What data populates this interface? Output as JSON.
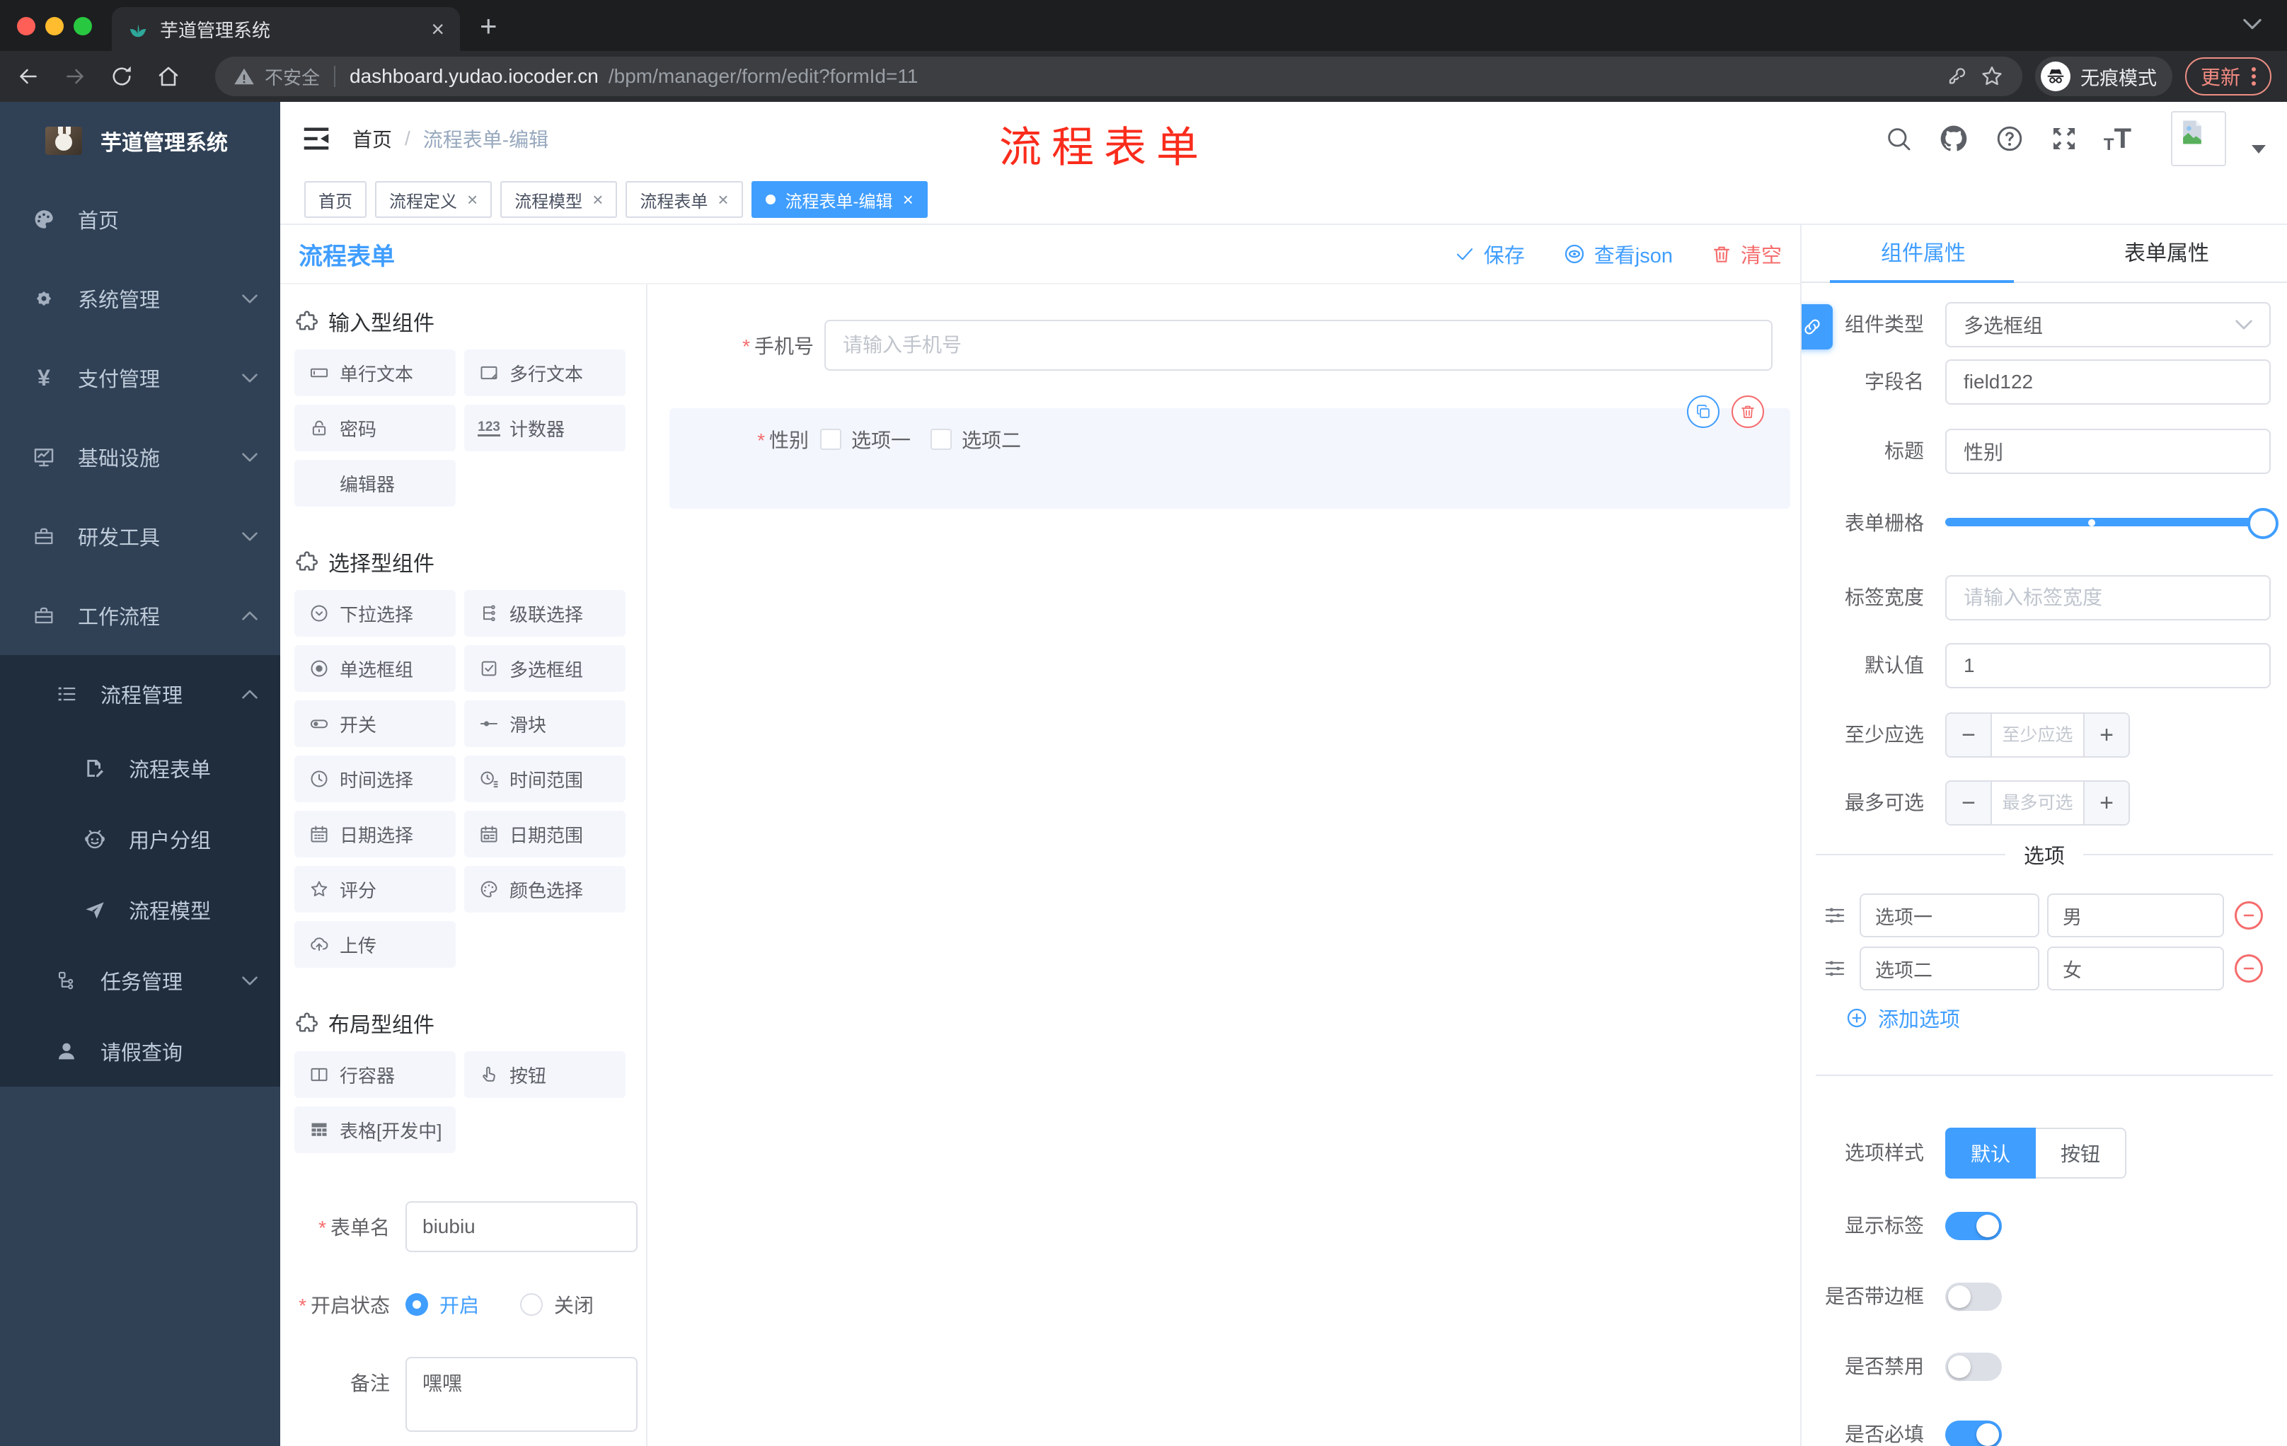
{
  "browser": {
    "tab_title": "芋道管理系统",
    "security_label": "不安全",
    "url_host": "dashboard.yudao.iocoder.cn",
    "url_path": "/bpm/manager/form/edit?formId=11",
    "incognito_label": "无痕模式",
    "update_label": "更新"
  },
  "annotation": {
    "text": "流程表单",
    "color": "#fa2c1c"
  },
  "sidebar": {
    "app_title": "芋道管理系统",
    "items": [
      {
        "label": "首页"
      },
      {
        "label": "系统管理"
      },
      {
        "label": "支付管理"
      },
      {
        "label": "基础设施"
      },
      {
        "label": "研发工具"
      },
      {
        "label": "工作流程"
      }
    ],
    "workflow_children": [
      {
        "label": "流程管理"
      },
      {
        "label": "流程表单"
      },
      {
        "label": "用户分组"
      },
      {
        "label": "流程模型"
      },
      {
        "label": "任务管理"
      },
      {
        "label": "请假查询"
      }
    ]
  },
  "header": {
    "breadcrumb_home": "首页",
    "breadcrumb_sep": "/",
    "breadcrumb_current": "流程表单-编辑"
  },
  "tags": [
    {
      "label": "首页"
    },
    {
      "label": "流程定义"
    },
    {
      "label": "流程模型"
    },
    {
      "label": "流程表单"
    },
    {
      "label": "流程表单-编辑"
    }
  ],
  "designer": {
    "title": "流程表单",
    "save_label": "保存",
    "view_json_label": "查看json",
    "clear_label": "清空",
    "palette": {
      "sections": [
        {
          "title": "输入型组件",
          "items": [
            {
              "label": "单行文本"
            },
            {
              "label": "多行文本"
            },
            {
              "label": "密码"
            },
            {
              "label": "计数器"
            },
            {
              "label": "编辑器"
            }
          ]
        },
        {
          "title": "选择型组件",
          "items": [
            {
              "label": "下拉选择"
            },
            {
              "label": "级联选择"
            },
            {
              "label": "单选框组"
            },
            {
              "label": "多选框组"
            },
            {
              "label": "开关"
            },
            {
              "label": "滑块"
            },
            {
              "label": "时间选择"
            },
            {
              "label": "时间范围"
            },
            {
              "label": "日期选择"
            },
            {
              "label": "日期范围"
            },
            {
              "label": "评分"
            },
            {
              "label": "颜色选择"
            },
            {
              "label": "上传"
            }
          ]
        },
        {
          "title": "布局型组件",
          "items": [
            {
              "label": "行容器"
            },
            {
              "label": "按钮"
            },
            {
              "label": "表格[开发中]"
            }
          ]
        }
      ]
    },
    "meta_form": {
      "name_label": "表单名",
      "name_value": "biubiu",
      "status_label": "开启状态",
      "status_on": "开启",
      "status_off": "关闭",
      "remark_label": "备注",
      "remark_value": "嘿嘿"
    },
    "canvas": {
      "phone_label": "手机号",
      "phone_placeholder": "请输入手机号",
      "gender_label": "性别",
      "gender_options": [
        "选项一",
        "选项二"
      ]
    }
  },
  "props": {
    "tab_component": "组件属性",
    "tab_form": "表单属性",
    "fields": {
      "type_label": "组件类型",
      "type_value": "多选框组",
      "name_label": "字段名",
      "name_value": "field122",
      "title_label": "标题",
      "title_value": "性别",
      "grid_label": "表单栅格",
      "label_width_label": "标签宽度",
      "label_width_placeholder": "请输入标签宽度",
      "default_label": "默认值",
      "default_value": "1",
      "min_label": "至少应选",
      "min_placeholder": "至少应选",
      "max_label": "最多可选",
      "max_placeholder": "最多可选"
    },
    "options_divider": "选项",
    "options": [
      {
        "label": "选项一",
        "value": "男"
      },
      {
        "label": "选项二",
        "value": "女"
      }
    ],
    "add_option_label": "添加选项",
    "option_style_label": "选项样式",
    "style_default": "默认",
    "style_button": "按钮",
    "toggles": [
      {
        "label": "显示标签",
        "on": true
      },
      {
        "label": "是否带边框",
        "on": false
      },
      {
        "label": "是否禁用",
        "on": false
      },
      {
        "label": "是否必填",
        "on": true
      }
    ]
  },
  "colors": {
    "accent": "#409eff",
    "danger": "#f56c6c",
    "sidebar_bg": "#304156",
    "submenu_bg": "#1f2d3d",
    "annotation_red": "#fa2c1c"
  }
}
